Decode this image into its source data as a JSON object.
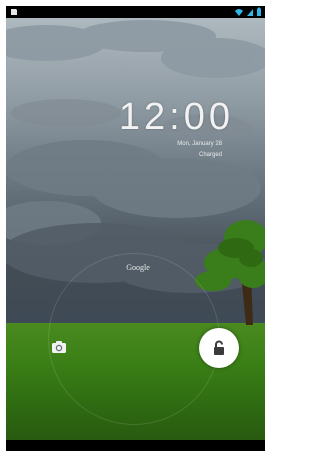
{
  "lockscreen": {
    "time": "12:00",
    "date": "Mon, January 28",
    "status": "Charged",
    "search_hint": "Google"
  },
  "colors": {
    "status_icon_accent": "#2fb6e9",
    "sky_dark": "#434c55",
    "grass": "#3a7f16",
    "unlock_fill": "#ffffff"
  },
  "icons": {
    "left_status": "sd-card-icon",
    "wifi": "wifi-icon",
    "signal": "signal-icon",
    "battery": "battery-icon",
    "camera": "camera-icon",
    "unlock": "unlock-icon"
  }
}
